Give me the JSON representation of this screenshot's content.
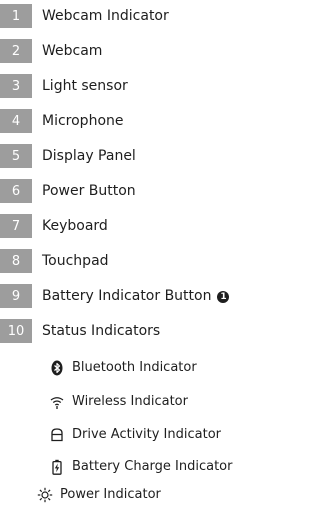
{
  "items": [
    {
      "number": "1",
      "label": "Webcam Indicator"
    },
    {
      "number": "2",
      "label": "Webcam"
    },
    {
      "number": "3",
      "label": "Light sensor"
    },
    {
      "number": "4",
      "label": "Microphone"
    },
    {
      "number": "5",
      "label": "Display Panel"
    },
    {
      "number": "6",
      "label": "Power Button"
    },
    {
      "number": "7",
      "label": "Keyboard"
    },
    {
      "number": "8",
      "label": "Touchpad"
    },
    {
      "number": "9",
      "label": "Battery Indicator Button",
      "note": "1"
    },
    {
      "number": "10",
      "label": "Status Indicators"
    }
  ],
  "status_indicators": [
    {
      "icon": "bluetooth-icon",
      "label": "Bluetooth Indicator"
    },
    {
      "icon": "wireless-icon",
      "label": "Wireless  Indicator"
    },
    {
      "icon": "drive-icon",
      "label": "Drive Activity Indicator"
    },
    {
      "icon": "battery-charge-icon",
      "label": "Battery Charge Indicator"
    },
    {
      "icon": "power-light-icon",
      "label": "Power Indicator"
    }
  ],
  "colors": {
    "number_box": "#9d9d9d",
    "text": "#1e1e1e"
  }
}
